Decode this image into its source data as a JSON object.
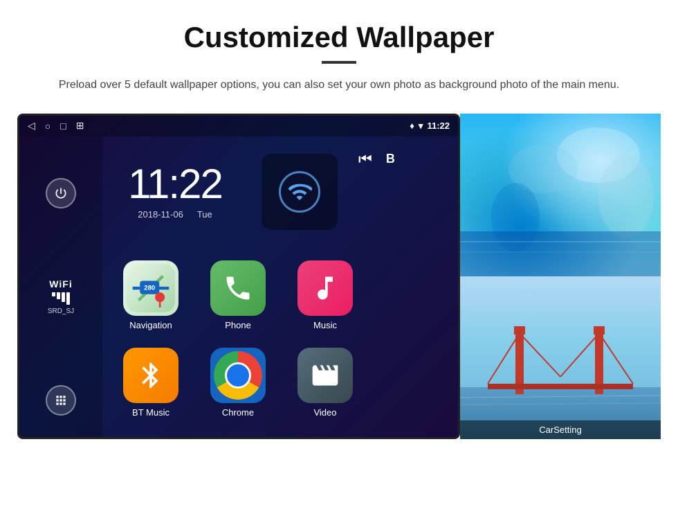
{
  "page": {
    "title": "Customized Wallpaper",
    "description": "Preload over 5 default wallpaper options, you can also set your own photo as background photo of the main menu."
  },
  "android": {
    "status_bar": {
      "back_icon": "◁",
      "home_icon": "○",
      "recents_icon": "□",
      "screenshot_icon": "⊞",
      "location_icon": "♦",
      "wifi_icon": "▾",
      "time": "11:22"
    },
    "clock": {
      "time": "11:22",
      "date": "2018-11-06",
      "day": "Tue"
    },
    "wifi": {
      "label": "WiFi",
      "ssid": "SRD_SJ"
    },
    "apps": [
      {
        "id": "nav",
        "label": "Navigation",
        "icon": "nav"
      },
      {
        "id": "phone",
        "label": "Phone",
        "icon": "phone"
      },
      {
        "id": "music",
        "label": "Music",
        "icon": "music"
      },
      {
        "id": "bt-music",
        "label": "BT Music",
        "icon": "bt"
      },
      {
        "id": "chrome",
        "label": "Chrome",
        "icon": "chrome"
      },
      {
        "id": "video",
        "label": "Video",
        "icon": "video"
      }
    ],
    "wallpapers": [
      {
        "id": "ice",
        "label": "Ice landscape"
      },
      {
        "id": "bridge",
        "label": "CarSetting"
      }
    ]
  },
  "icons": {
    "power": "⏻",
    "apps_grid": "⊞",
    "back": "◁",
    "home": "○",
    "recents": "□",
    "music_note": "♪",
    "skip_back": "⏮"
  }
}
